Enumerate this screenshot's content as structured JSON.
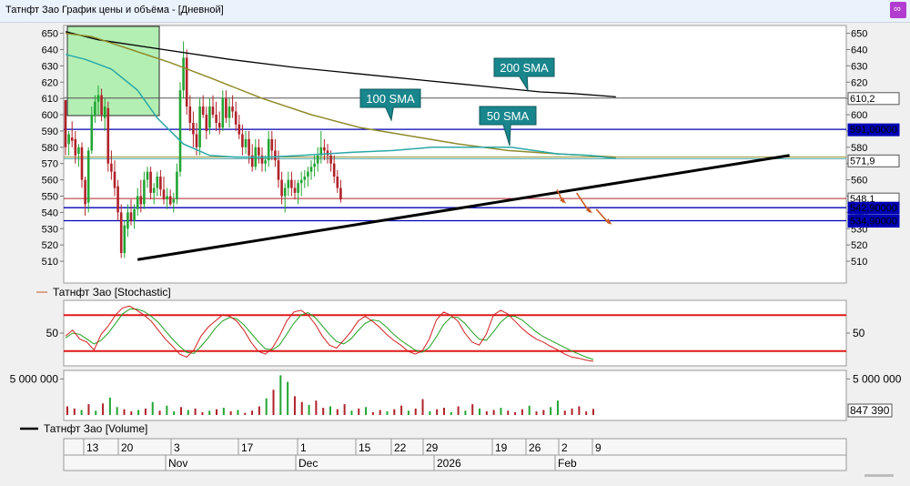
{
  "window": {
    "title": "Татнфт Зао График цены и объёма - [Дневной]"
  },
  "colors": {
    "up": "#22a532",
    "down": "#b0222a",
    "sma50": "#2aa8a8",
    "sma100": "#8f8a2a",
    "sma200": "#000000",
    "levelLine": "#0000b4",
    "stochK": "#d02020",
    "stochD": "#20a020",
    "callout": "#18868c"
  },
  "legends": {
    "stochastic": "Татнфт Зао [Stochastic]",
    "volume": "Татнфт Зао [Volume]"
  },
  "price_badges": {
    "sma200": "610,2",
    "level591": "591,00000",
    "current": "571,9",
    "last": "548,1",
    "level543": "542,90000",
    "level535": "534,90000",
    "volume_last": "847 390"
  },
  "callouts": {
    "sma200": "200 SMA",
    "sma100": "100 SMA",
    "sma50": "50 SMA"
  },
  "chart_data": [
    {
      "type": "candlestick",
      "panel": "price",
      "ylim": [
        505,
        652
      ],
      "yticks": [
        510,
        520,
        530,
        540,
        550,
        560,
        570,
        580,
        590,
        600,
        610,
        620,
        630,
        640,
        650
      ],
      "candles": [
        [
          609,
          605,
          575,
          580
        ],
        [
          582,
          590,
          575,
          588
        ],
        [
          586,
          596,
          580,
          584
        ],
        [
          585,
          590,
          570,
          575
        ],
        [
          576,
          582,
          568,
          580
        ],
        [
          580,
          583,
          555,
          560
        ],
        [
          560,
          562,
          538,
          545
        ],
        [
          546,
          580,
          540,
          578
        ],
        [
          578,
          605,
          576,
          600
        ],
        [
          600,
          612,
          595,
          608
        ],
        [
          608,
          618,
          600,
          612
        ],
        [
          612,
          616,
          596,
          600
        ],
        [
          598,
          610,
          590,
          605
        ],
        [
          604,
          608,
          565,
          570
        ],
        [
          570,
          578,
          560,
          565
        ],
        [
          565,
          572,
          550,
          555
        ],
        [
          556,
          560,
          535,
          540
        ],
        [
          540,
          545,
          512,
          515
        ],
        [
          515,
          535,
          512,
          532
        ],
        [
          530,
          545,
          525,
          540
        ],
        [
          540,
          548,
          532,
          535
        ],
        [
          535,
          545,
          530,
          542
        ],
        [
          542,
          555,
          538,
          550
        ],
        [
          550,
          560,
          540,
          545
        ],
        [
          545,
          565,
          542,
          560
        ],
        [
          560,
          568,
          555,
          565
        ],
        [
          565,
          568,
          548,
          552
        ],
        [
          552,
          558,
          545,
          555
        ],
        [
          555,
          565,
          550,
          562
        ],
        [
          562,
          566,
          550,
          554
        ],
        [
          554,
          562,
          545,
          548
        ],
        [
          548,
          555,
          542,
          550
        ],
        [
          550,
          554,
          544,
          545
        ],
        [
          546,
          552,
          540,
          548
        ],
        [
          548,
          570,
          545,
          565
        ],
        [
          565,
          620,
          562,
          615
        ],
        [
          615,
          645,
          610,
          635
        ],
        [
          635,
          640,
          600,
          605
        ],
        [
          605,
          612,
          590,
          595
        ],
        [
          595,
          602,
          580,
          588
        ],
        [
          588,
          595,
          575,
          580
        ],
        [
          580,
          610,
          575,
          605
        ],
        [
          605,
          612,
          598,
          600
        ],
        [
          600,
          605,
          585,
          590
        ],
        [
          592,
          610,
          588,
          605
        ],
        [
          605,
          612,
          598,
          600
        ],
        [
          600,
          608,
          590,
          595
        ],
        [
          595,
          602,
          588,
          592
        ],
        [
          592,
          615,
          590,
          610
        ],
        [
          610,
          615,
          595,
          598
        ],
        [
          598,
          610,
          592,
          605
        ],
        [
          605,
          612,
          598,
          602
        ],
        [
          602,
          608,
          590,
          594
        ],
        [
          594,
          600,
          585,
          588
        ],
        [
          588,
          594,
          575,
          580
        ],
        [
          580,
          590,
          576,
          585
        ],
        [
          585,
          590,
          570,
          575
        ],
        [
          575,
          582,
          565,
          568
        ],
        [
          568,
          585,
          566,
          580
        ],
        [
          580,
          585,
          570,
          575
        ],
        [
          575,
          580,
          565,
          570
        ],
        [
          570,
          575,
          565,
          572
        ],
        [
          572,
          590,
          568,
          585
        ],
        [
          585,
          590,
          572,
          578
        ],
        [
          578,
          585,
          568,
          572
        ],
        [
          572,
          578,
          555,
          560
        ],
        [
          560,
          565,
          545,
          550
        ],
        [
          550,
          558,
          540,
          555
        ],
        [
          555,
          565,
          550,
          560
        ],
        [
          560,
          565,
          550,
          555
        ],
        [
          555,
          560,
          548,
          552
        ],
        [
          552,
          560,
          545,
          558
        ],
        [
          558,
          565,
          550,
          560
        ],
        [
          560,
          566,
          555,
          562
        ],
        [
          562,
          568,
          556,
          565
        ],
        [
          565,
          572,
          560,
          568
        ],
        [
          568,
          575,
          562,
          570
        ],
        [
          570,
          580,
          565,
          575
        ],
        [
          575,
          590,
          570,
          580
        ],
        [
          580,
          585,
          572,
          578
        ],
        [
          578,
          582,
          570,
          575
        ],
        [
          575,
          578,
          565,
          570
        ],
        [
          570,
          575,
          558,
          562
        ],
        [
          562,
          566,
          552,
          555
        ],
        [
          555,
          560,
          546,
          548
        ]
      ],
      "sma200": [
        [
          0,
          651
        ],
        [
          10,
          646
        ],
        [
          30,
          640
        ],
        [
          50,
          634
        ],
        [
          70,
          629
        ],
        [
          90,
          625
        ],
        [
          110,
          621
        ],
        [
          130,
          617
        ],
        [
          145,
          614
        ],
        [
          155,
          613
        ],
        [
          168,
          611
        ]
      ],
      "sma100": [
        [
          0,
          650
        ],
        [
          8,
          648
        ],
        [
          20,
          640
        ],
        [
          32,
          632
        ],
        [
          45,
          622
        ],
        [
          60,
          610
        ],
        [
          75,
          600
        ],
        [
          90,
          592
        ],
        [
          105,
          587
        ],
        [
          120,
          582
        ],
        [
          135,
          578
        ],
        [
          150,
          576
        ],
        [
          168,
          574
        ]
      ],
      "sma50": [
        [
          0,
          637
        ],
        [
          6,
          634
        ],
        [
          14,
          628
        ],
        [
          22,
          615
        ],
        [
          28,
          598
        ],
        [
          36,
          582
        ],
        [
          44,
          575
        ],
        [
          52,
          574
        ],
        [
          62,
          574
        ],
        [
          72,
          575
        ],
        [
          88,
          577
        ],
        [
          100,
          578
        ],
        [
          112,
          580
        ],
        [
          124,
          580
        ],
        [
          136,
          580
        ],
        [
          150,
          576
        ],
        [
          160,
          575
        ],
        [
          168,
          573
        ]
      ],
      "trendline": [
        [
          22,
          511
        ],
        [
          221,
          575
        ]
      ],
      "hlines": [
        610.2,
        591,
        574,
        573,
        548.5,
        542.9,
        534.9
      ],
      "forecast": [
        [
          [
            150,
            554
          ],
          [
            152,
            546
          ]
        ],
        [
          [
            156,
            552
          ],
          [
            160,
            540
          ]
        ],
        [
          [
            162,
            542
          ],
          [
            166,
            533
          ]
        ]
      ]
    },
    {
      "type": "line",
      "panel": "stochastic",
      "ylim": [
        0,
        100
      ],
      "yticks": [
        50
      ],
      "levels": [
        80,
        20
      ],
      "k": [
        45,
        55,
        40,
        35,
        22,
        48,
        62,
        80,
        92,
        95,
        88,
        80,
        70,
        55,
        40,
        28,
        15,
        10,
        22,
        45,
        60,
        70,
        80,
        78,
        70,
        55,
        35,
        20,
        15,
        25,
        45,
        70,
        85,
        88,
        80,
        65,
        45,
        30,
        25,
        38,
        52,
        70,
        78,
        70,
        60,
        48,
        38,
        30,
        20,
        15,
        20,
        40,
        72,
        85,
        80,
        70,
        50,
        35,
        30,
        48,
        80,
        88,
        82,
        70,
        58,
        48,
        40,
        35,
        28,
        22,
        15,
        10,
        8,
        5,
        3
      ],
      "d": [
        42,
        50,
        48,
        40,
        32,
        38,
        50,
        66,
        82,
        90,
        90,
        86,
        78,
        68,
        54,
        40,
        28,
        18,
        16,
        28,
        42,
        58,
        70,
        76,
        74,
        64,
        50,
        36,
        24,
        22,
        30,
        48,
        66,
        80,
        84,
        76,
        62,
        48,
        36,
        32,
        40,
        54,
        66,
        72,
        70,
        60,
        48,
        38,
        30,
        22,
        18,
        26,
        44,
        64,
        76,
        76,
        66,
        52,
        40,
        38,
        52,
        68,
        78,
        78,
        72,
        62,
        52,
        44,
        38,
        32,
        26,
        20,
        15,
        10,
        6
      ]
    },
    {
      "type": "bar",
      "panel": "volume",
      "ylim": [
        0,
        5800000
      ],
      "yticks": [
        5000000
      ],
      "ytick_labels": [
        "5 000 000"
      ],
      "values": [
        [
          1200000,
          0
        ],
        [
          900000,
          0
        ],
        [
          700000,
          1
        ],
        [
          1500000,
          0
        ],
        [
          600000,
          1
        ],
        [
          1600000,
          0
        ],
        [
          2400000,
          1
        ],
        [
          1100000,
          1
        ],
        [
          800000,
          0
        ],
        [
          500000,
          0
        ],
        [
          700000,
          1
        ],
        [
          900000,
          0
        ],
        [
          1800000,
          1
        ],
        [
          600000,
          0
        ],
        [
          1300000,
          1
        ],
        [
          500000,
          1
        ],
        [
          1100000,
          0
        ],
        [
          700000,
          1
        ],
        [
          900000,
          0
        ],
        [
          400000,
          0
        ],
        [
          600000,
          1
        ],
        [
          800000,
          0
        ],
        [
          1000000,
          1
        ],
        [
          500000,
          0
        ],
        [
          700000,
          1
        ],
        [
          300000,
          0
        ],
        [
          600000,
          0
        ],
        [
          1200000,
          0
        ],
        [
          2300000,
          1
        ],
        [
          3500000,
          0
        ],
        [
          5500000,
          1
        ],
        [
          4600000,
          1
        ],
        [
          2600000,
          0
        ],
        [
          1800000,
          0
        ],
        [
          1400000,
          1
        ],
        [
          2000000,
          0
        ],
        [
          1000000,
          0
        ],
        [
          1200000,
          1
        ],
        [
          800000,
          0
        ],
        [
          1500000,
          0
        ],
        [
          600000,
          1
        ],
        [
          900000,
          0
        ],
        [
          1100000,
          1
        ],
        [
          400000,
          0
        ],
        [
          700000,
          0
        ],
        [
          500000,
          1
        ],
        [
          800000,
          0
        ],
        [
          1300000,
          0
        ],
        [
          600000,
          1
        ],
        [
          900000,
          0
        ],
        [
          2200000,
          0
        ],
        [
          500000,
          1
        ],
        [
          800000,
          0
        ],
        [
          1000000,
          0
        ],
        [
          400000,
          1
        ],
        [
          1200000,
          0
        ],
        [
          600000,
          1
        ],
        [
          1500000,
          0
        ],
        [
          900000,
          1
        ],
        [
          500000,
          0
        ],
        [
          700000,
          0
        ],
        [
          1000000,
          1
        ],
        [
          600000,
          0
        ],
        [
          400000,
          0
        ],
        [
          800000,
          0
        ],
        [
          1300000,
          1
        ],
        [
          500000,
          0
        ],
        [
          700000,
          0
        ],
        [
          1100000,
          1
        ],
        [
          2000000,
          1
        ],
        [
          600000,
          0
        ],
        [
          900000,
          0
        ],
        [
          1200000,
          0
        ],
        [
          500000,
          0
        ],
        [
          847390,
          0
        ]
      ]
    }
  ],
  "xaxis": {
    "ticks": [
      "13",
      "20",
      "3",
      "17",
      "1",
      "15",
      "22",
      "29",
      "19",
      "26",
      "2",
      "9"
    ],
    "months": [
      "Nov",
      "Dec",
      "2026",
      "Feb"
    ]
  }
}
